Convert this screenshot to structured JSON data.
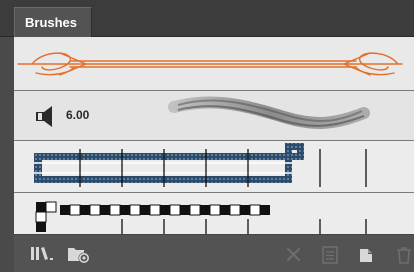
{
  "panel": {
    "tab_label": "Brushes"
  },
  "brushes": [
    {
      "type": "art-arrow-brush",
      "color": "#e2702b"
    },
    {
      "type": "bristle-brush",
      "size": "6.00"
    },
    {
      "type": "pattern-brush",
      "color": "#2c4a6a"
    },
    {
      "type": "checker-pattern-brush"
    }
  ],
  "toolbar": {
    "icons": [
      "brush-libraries-menu-icon",
      "libraries-panel-icon",
      "remove-brush-stroke-icon",
      "brush-options-icon",
      "new-brush-icon",
      "delete-brush-icon"
    ]
  }
}
